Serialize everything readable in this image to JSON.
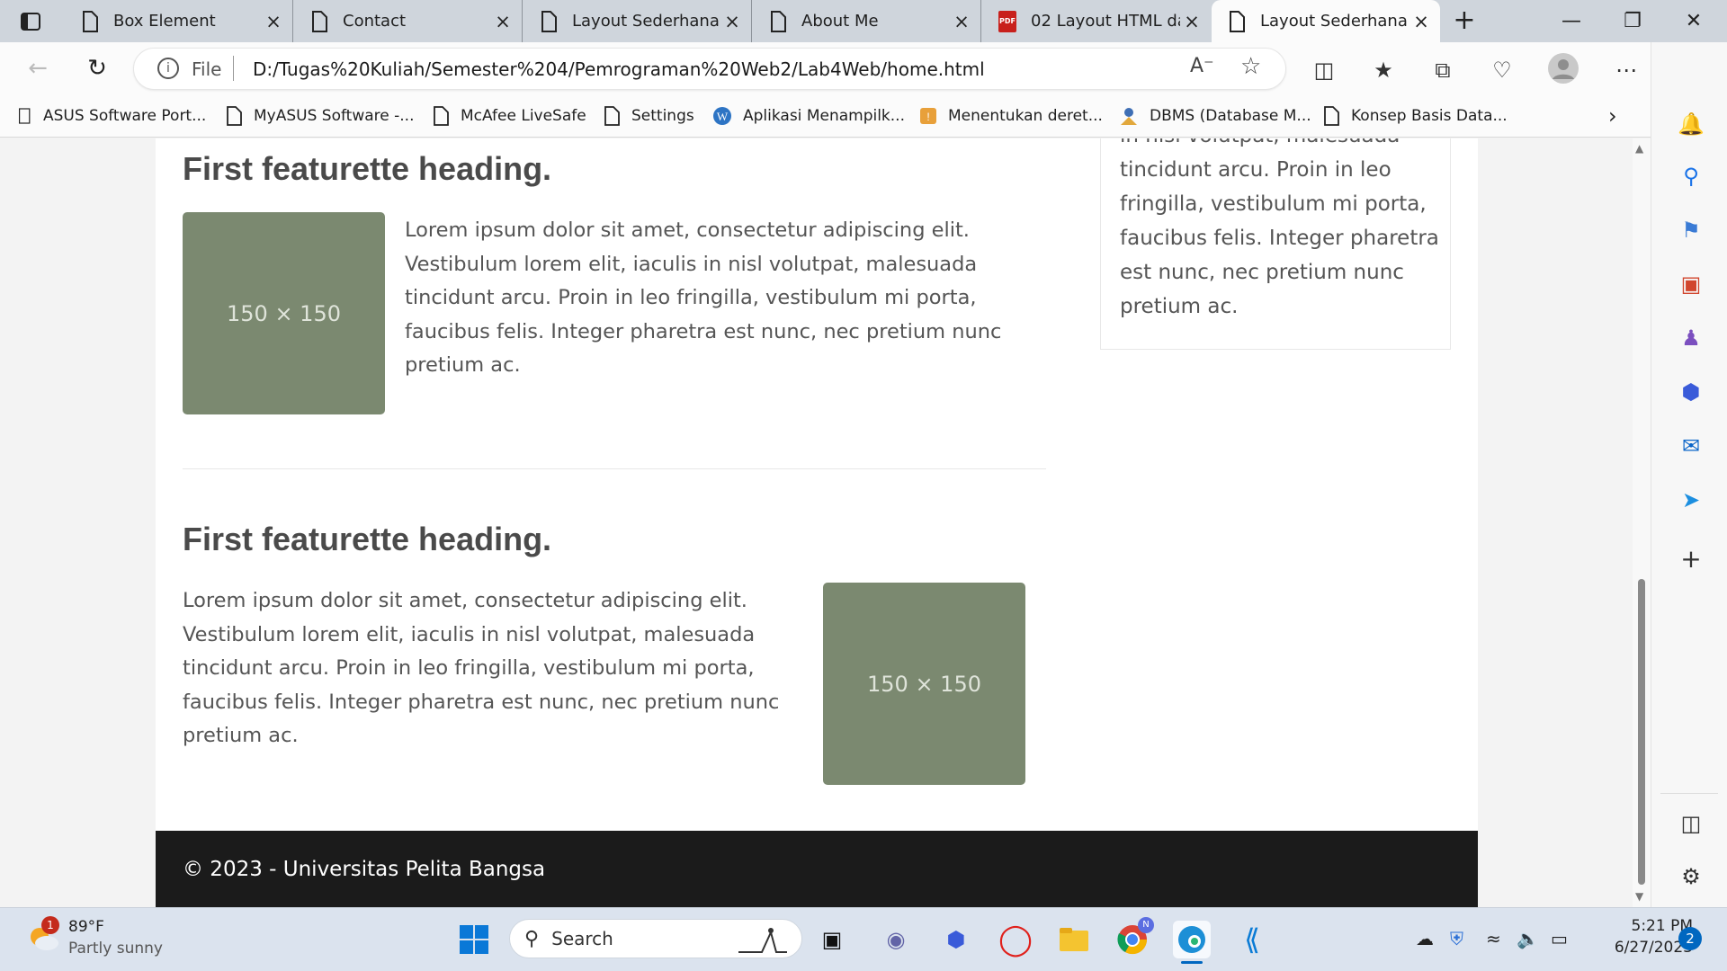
{
  "tabs": [
    {
      "label": "Box Element",
      "icon": "page-icon",
      "active": false
    },
    {
      "label": "Contact",
      "icon": "page-icon",
      "active": false
    },
    {
      "label": "Layout Sederhana",
      "icon": "page-icon",
      "active": false
    },
    {
      "label": "About Me",
      "icon": "page-icon",
      "active": false
    },
    {
      "label": "02 Layout HTML da",
      "icon": "pdf-icon",
      "active": false
    },
    {
      "label": "Layout Sederhana",
      "icon": "page-icon",
      "active": true
    }
  ],
  "tab_close_glyph": "×",
  "pdf_badge": "PDF",
  "address": {
    "scheme": "File",
    "url": "D:/Tugas%20Kuliah/Semester%204/Pemrograman%20Web2/Lab4Web/home.html"
  },
  "bookmarks": [
    "ASUS Software Port...",
    "MyASUS Software -...",
    "McAfee LiveSafe",
    "Settings",
    "Aplikasi Menampilk...",
    "Menentukan deret...",
    "DBMS (Database M...",
    "Konsep Basis Data..."
  ],
  "page": {
    "sidebar_text": [
      "in nisl volutpat, malesuada",
      "tincidunt arcu. Proin in leo",
      "fringilla, vestibulum mi porta,",
      "faucibus felis. Integer pharetra",
      "est nunc, nec pretium nunc",
      "pretium ac."
    ],
    "featurette1": {
      "heading": "First featurette heading.",
      "image_label": "150 × 150",
      "lines": [
        "Lorem ipsum dolor sit amet, consectetur adipiscing elit.",
        "Vestibulum lorem elit, iaculis in nisl volutpat, malesuada",
        "tincidunt arcu. Proin in leo fringilla, vestibulum mi porta,",
        "faucibus felis. Integer pharetra est nunc, nec pretium nunc",
        "pretium ac."
      ]
    },
    "featurette2": {
      "heading": "First featurette heading.",
      "image_label": "150 × 150",
      "lines": [
        "Lorem ipsum dolor sit amet, consectetur adipiscing elit.",
        "Vestibulum lorem elit, iaculis in nisl volutpat, malesuada",
        "tincidunt arcu. Proin in leo fringilla, vestibulum mi porta,",
        "faucibus felis. Integer pharetra est nunc, nec pretium nunc",
        "pretium ac."
      ]
    },
    "footer": "© 2023 - Universitas Pelita Bangsa"
  },
  "taskbar": {
    "weather_temp": "89°F",
    "weather_desc": "Partly sunny",
    "weather_badge": "1",
    "search_placeholder": "Search",
    "time": "5:21 PM",
    "date": "6/27/2023",
    "notification_count": "2",
    "chrome_badge": "N"
  },
  "colors": {
    "placeholder": "#7b8970",
    "footer": "#1b1b1b",
    "accent": "#0067c0"
  }
}
